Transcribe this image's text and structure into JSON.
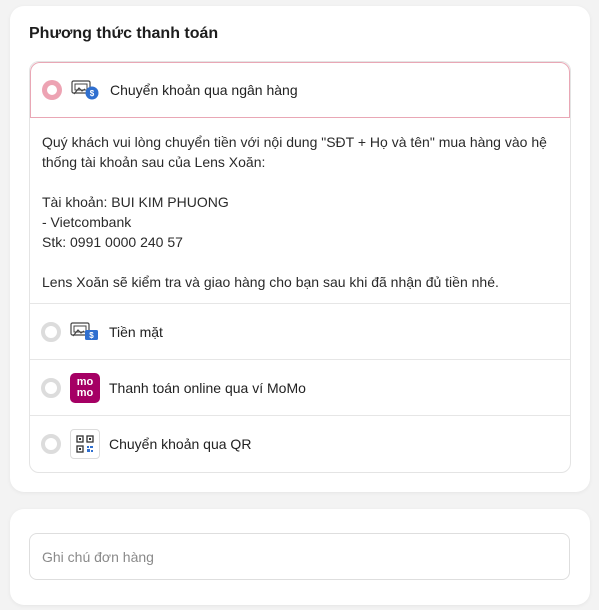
{
  "payment": {
    "title": "Phương thức thanh toán",
    "methods": [
      {
        "label": "Chuyển khoản qua ngân hàng",
        "icon": "bank-transfer-icon",
        "selected": true
      },
      {
        "label": "Tiền mặt",
        "icon": "cash-icon",
        "selected": false
      },
      {
        "label": "Thanh toán online qua ví MoMo",
        "icon": "momo-logo",
        "selected": false
      },
      {
        "label": "Chuyển khoản qua QR",
        "icon": "qr-code-icon",
        "selected": false
      }
    ],
    "bank_details": {
      "instruction": "Quý khách vui lòng chuyển tiền với nội dung \"SĐT + Họ và tên\" mua hàng vào hệ thống tài khoản sau của Lens Xoăn:",
      "account": "Tài khoản: BUI KIM PHUONG",
      "bank": "- Vietcombank",
      "number": "Stk: 0991 0000 240 57",
      "closing": "Lens Xoăn sẽ kiểm tra và giao hàng cho bạn sau khi đã nhận đủ tiền nhé."
    },
    "momo_logo_text": [
      "mo",
      "mo"
    ],
    "colors": {
      "accent": "#eda3b3",
      "momo": "#a50064"
    }
  },
  "note": {
    "placeholder": "Ghi chú đơn hàng"
  }
}
